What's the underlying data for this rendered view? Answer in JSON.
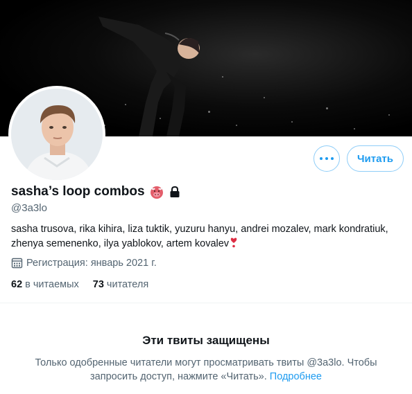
{
  "profile": {
    "display_name": "sasha’s loop combos",
    "handle": "@3a3lo",
    "bio": "sasha trusova, rika kihira, liza tuktik, yuzuru hanyu, andrei mozalev, mark kondratiuk, zhenya semenenko, ilya yablokov, artem kovalev",
    "joined": "Регистрация: январь 2021 г.",
    "following_count": "62",
    "following_label": "в читаемых",
    "followers_count": "73",
    "followers_label": "читателя"
  },
  "actions": {
    "follow_label": "Читать"
  },
  "protected": {
    "title": "Эти твиты защищены",
    "text": "Только одобренные читатели могут просматривать твиты @3a3lo. Чтобы запросить доступ, нажмите «Читать».",
    "learn_more": "Подробнее"
  },
  "icons": {
    "bio_end": "heart-exclamation-icon",
    "name_emoji": "bull-face-icon",
    "protected": "lock-icon",
    "joined": "calendar-icon",
    "more": "more-dots-icon"
  },
  "colors": {
    "accent": "#1d9bf0",
    "text": "#0f1419",
    "secondary": "#536471"
  }
}
